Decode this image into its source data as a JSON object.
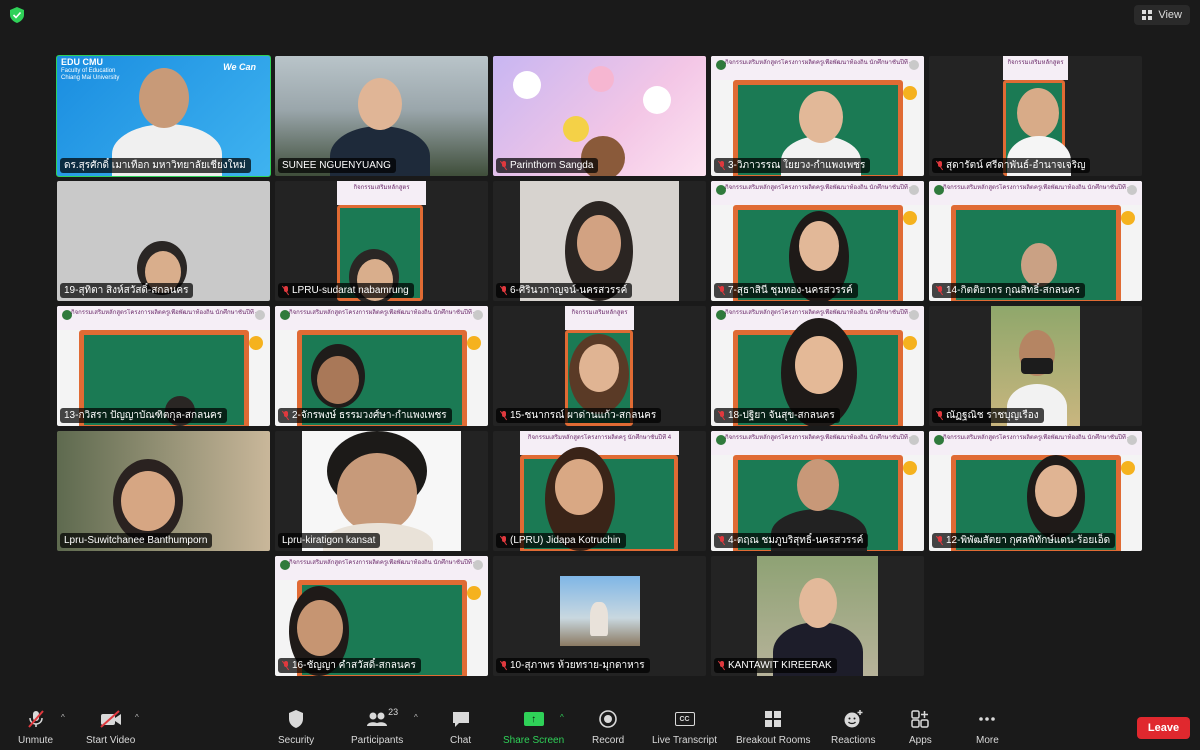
{
  "window": {
    "view_label": "View",
    "colors": {
      "active_speaker": "#2fd158",
      "leave": "#e0282e",
      "mute": "#e0393e"
    }
  },
  "tiles": [
    {
      "name": "ดร.สุรศักดิ์ เมาเทือก มหาวิทยาลัยเชียงใหม่",
      "muted": false,
      "logo_top": "EDU CMU",
      "logo_line1": "Faculty of Education",
      "logo_line2": "Chiang Mai University",
      "slogan": "We Can"
    },
    {
      "name": "SUNEE NGUENYUANG",
      "muted": false
    },
    {
      "name": "Parinthorn Sangda",
      "muted": true
    },
    {
      "name": "3-วิภาวรรณ ใยยวง-กำแพงเพชร",
      "muted": true
    },
    {
      "name": "สุดารัตน์ ศรีดาพันธ์-อำนาจเจริญ",
      "muted": true
    },
    {
      "name": "19-สุทิตา สิงห์สวัสดิ์-สกลนคร",
      "muted": false
    },
    {
      "name": "LPRU-sudarat nabamrung",
      "muted": true
    },
    {
      "name": "6-ศิรินวกาญจน์-นครสวรรค์",
      "muted": true
    },
    {
      "name": "7-สุธาสินี ชุมทอง-นครสวรรค์",
      "muted": true
    },
    {
      "name": "14-กิตติยากร กุณสิทธิ์-สกลนคร",
      "muted": true
    },
    {
      "name": "13-กวิสรา ปัญญาบัณฑิตกุล-สกลนคร",
      "muted": false
    },
    {
      "name": "2-จักรพงษ์ ธรรมวงศ์ษา-กำแพงเพชร",
      "muted": true
    },
    {
      "name": "15-ชนากรณ์ ผาด่านแก้ว-สกลนคร",
      "muted": true
    },
    {
      "name": "18-ปฐิยา จันสุข-สกลนคร",
      "muted": true
    },
    {
      "name": "ณัฏฐณิช ราชบุญเรือง",
      "muted": true
    },
    {
      "name": "Lpru-Suwitchanee Banthumporn",
      "muted": false
    },
    {
      "name": "Lpru-kiratigon kansat",
      "muted": false
    },
    {
      "name": "(LPRU) Jidapa Kotruchin",
      "muted": true
    },
    {
      "name": "4-ตฤณ ชมภูบริสุทธิ์-นครสวรรค์",
      "muted": true
    },
    {
      "name": "12-พิพัฒสัตยา กุศลพิทักษ์แดน-ร้อยเอ็ด",
      "muted": true
    },
    {
      "name": "16-ชัญญา คำสวัสดิ์-สกลนคร",
      "muted": true
    },
    {
      "name": "10-สุภาพร ห้วยทราย-มุกดาหาร",
      "muted": true
    },
    {
      "name": "KANTAWIT KIREERAK",
      "muted": true
    }
  ],
  "toolbar": {
    "unmute": "Unmute",
    "start_video": "Start Video",
    "security": "Security",
    "participants": "Participants",
    "participants_count": "23",
    "chat": "Chat",
    "share_screen": "Share Screen",
    "record": "Record",
    "live_transcript": "Live Transcript",
    "cc": "CC",
    "breakout_rooms": "Breakout Rooms",
    "reactions": "Reactions",
    "apps": "Apps",
    "more": "More",
    "leave": "Leave"
  }
}
